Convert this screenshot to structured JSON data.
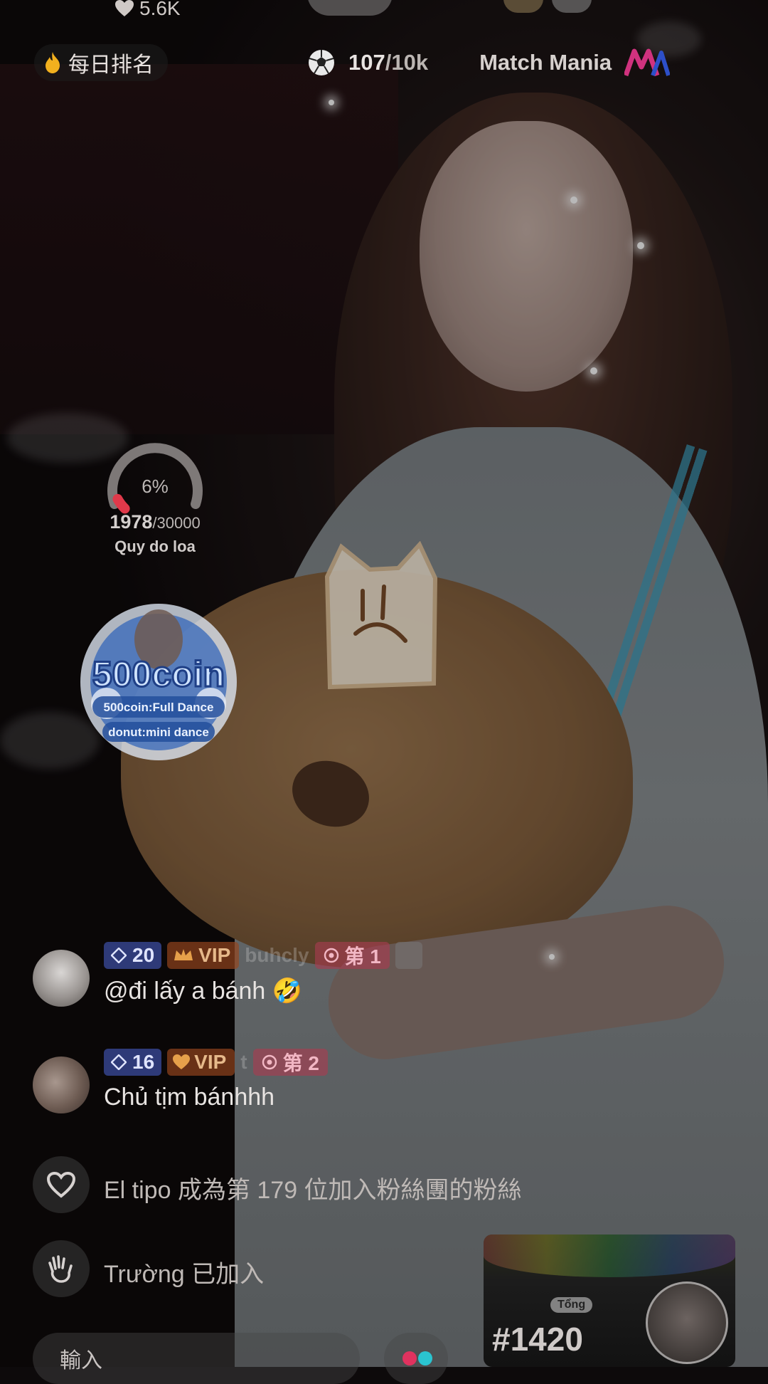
{
  "header": {
    "like_count": "5.6K",
    "daily_rank_label": "每日排名",
    "match_progress": "107",
    "match_goal": "/10k",
    "match_name": "Match Mania"
  },
  "gauge": {
    "percent_label": "6%",
    "percent_value": 6,
    "current": "1978",
    "goal": "/30000",
    "name": "Quy do loa"
  },
  "promo_badge": {
    "title": "500coin",
    "line1": "500coin:Full Dance",
    "line2": "donut:mini dance"
  },
  "comments": [
    {
      "level": "20",
      "vip": "VIP",
      "username": "buhcly",
      "rank": "第 1",
      "text": "@đi lấy a bánh"
    },
    {
      "level": "16",
      "vip": "VIP",
      "username": "t",
      "rank": "第 2",
      "text": "Chủ tịm bánhhh"
    }
  ],
  "system_messages": [
    {
      "icon": "heart-outline-icon",
      "text": "El tipo 成為第 179 位加入粉絲團的粉絲"
    },
    {
      "icon": "waving-hand-icon",
      "text": "Trường 已加入"
    }
  ],
  "input": {
    "placeholder": "輸入"
  },
  "promo_card": {
    "tag": "Tổng",
    "rank": "#1420"
  },
  "colors": {
    "gauge_track": "#9a9594",
    "gauge_fill": "#e0394a",
    "level_badge": "#465abe",
    "vip_badge": "#96461e",
    "rank_badge": "#aa3c50"
  }
}
